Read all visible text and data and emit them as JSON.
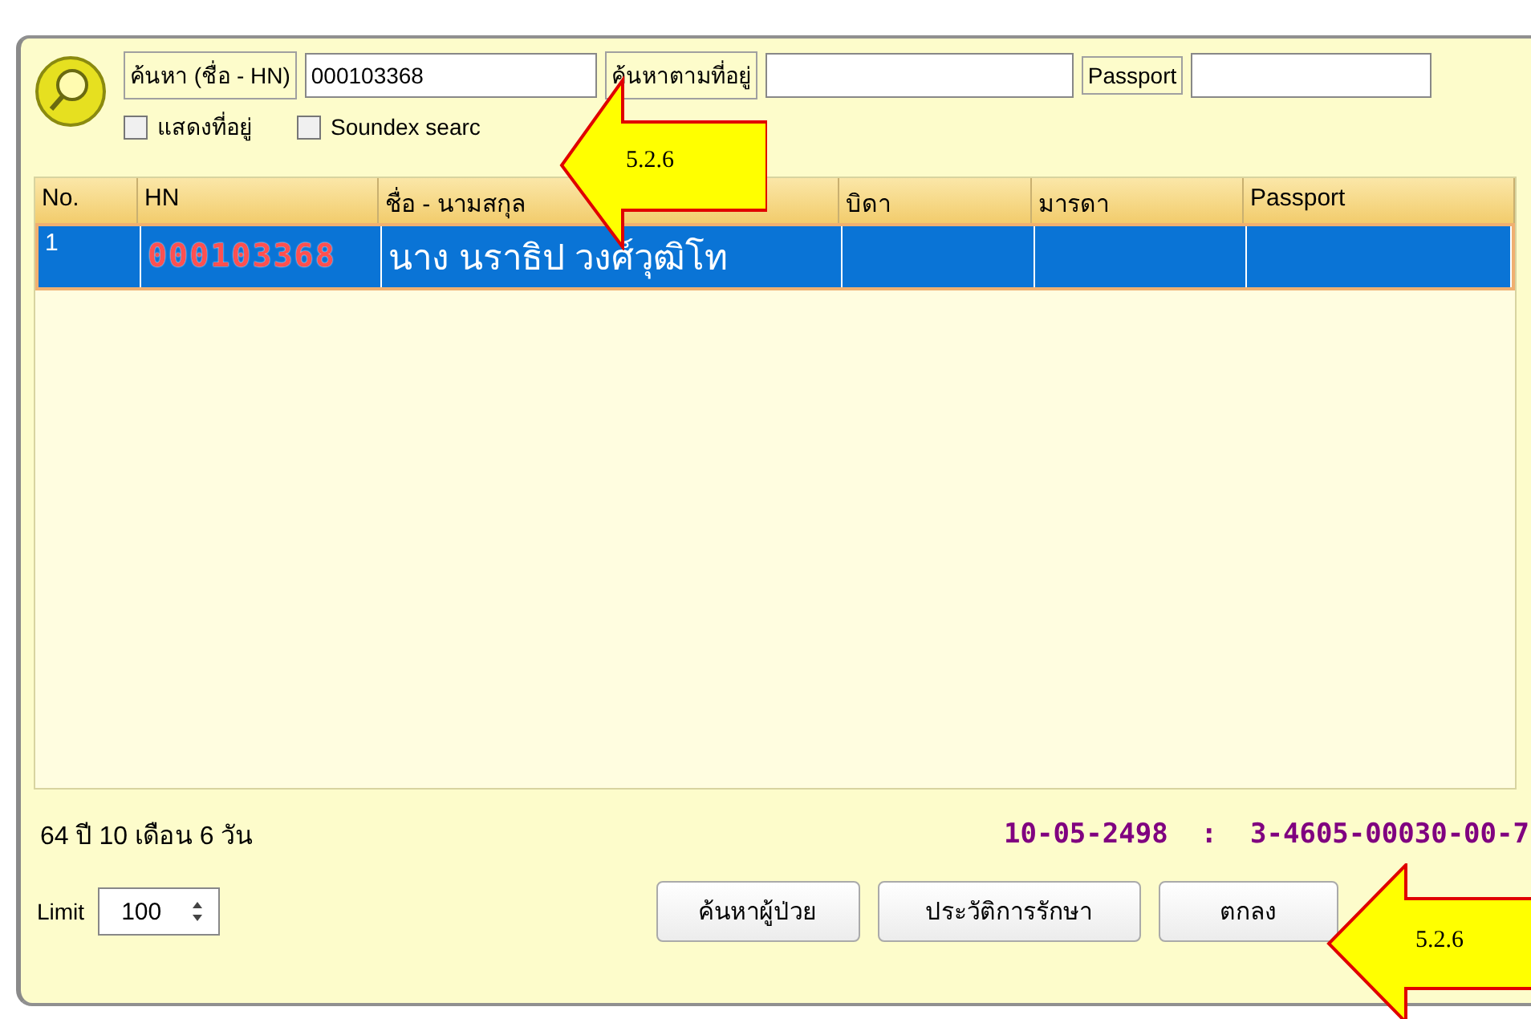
{
  "search": {
    "name_label": "ค้นหา (ชื่อ - HN)",
    "name_value": "000103368",
    "address_button": "ค้นหาตามที่อยู่",
    "passport_label": "Passport"
  },
  "options": [
    {
      "label": "แสดงที่อยู่",
      "checked": false
    },
    {
      "label": "Soundex searc",
      "checked": false
    }
  ],
  "table": {
    "columns": [
      "No.",
      "HN",
      "ชื่อ - นามสกุล",
      "บิดา",
      "มารดา",
      "Passport"
    ],
    "rows": [
      {
        "cells": [
          "1",
          "000103368",
          "นาง นราธิป  วงศ์วุฒิโท",
          "",
          "",
          ""
        ],
        "selected": true
      }
    ]
  },
  "age": "64 ปี 10 เดือน 6 วัน",
  "id_info": "10-05-2498  :  3-4605-00030-00-7",
  "limit": {
    "label": "Limit",
    "value": "100"
  },
  "buttons": [
    "ค้นหาผู้ป่วย",
    "ประวัติการรักษา",
    "ตกลง"
  ],
  "callouts": [
    "5.2.6",
    "5.2.6"
  ]
}
